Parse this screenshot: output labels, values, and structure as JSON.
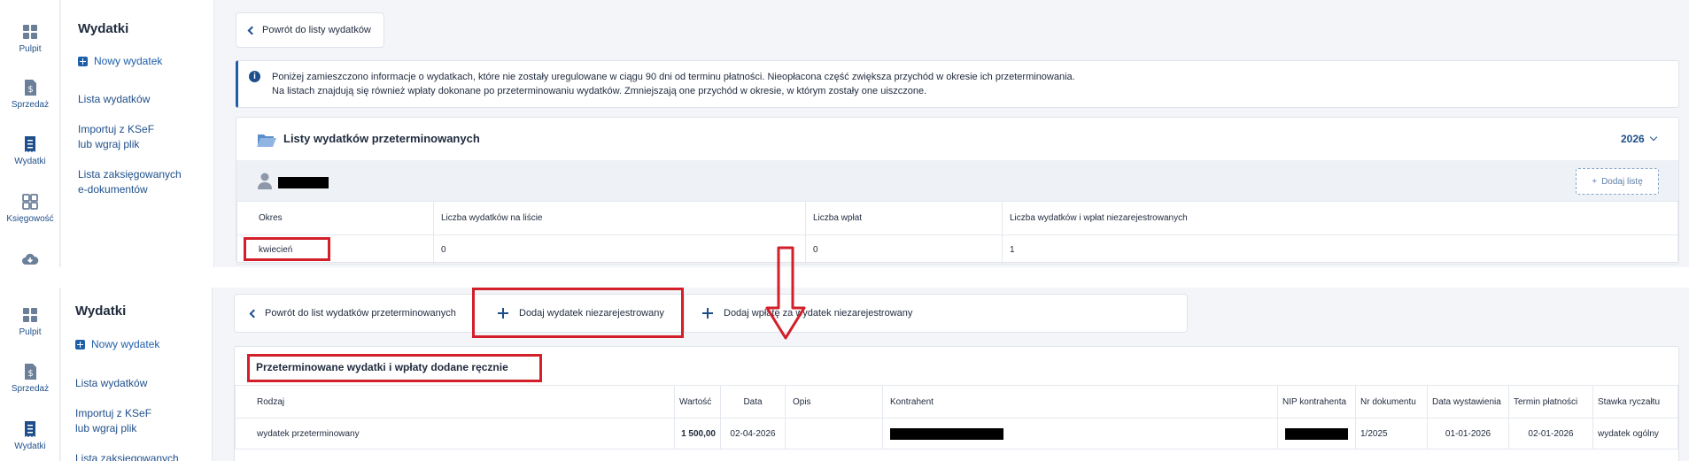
{
  "nav": {
    "pulpit": "Pulpit",
    "sprzedaz": "Sprzedaż",
    "wydatki": "Wydatki",
    "ksiegowosc": "Księgowość"
  },
  "sidebar": {
    "title": "Wydatki",
    "new_expense": "Nowy wydatek",
    "list": "Lista wydatków",
    "import_l1": "Importuj z KSeF",
    "import_l2": "lub wgraj plik",
    "booked_l1": "Lista zaksięgowanych",
    "booked_l2": "e-dokumentów"
  },
  "top": {
    "back_button": "Powrót do listy wydatków",
    "info_line1": "Poniżej zamieszczono informacje o wydatkach, które nie zostały uregulowane w ciągu 90 dni od terminu płatności. Nieopłacona część zwiększa przychód w okresie ich przeterminowania.",
    "info_line2": "Na listach znajdują się również wpłaty dokonane po przeterminowaniu wydatków. Zmniejszają one przychód w okresie, w którym zostały one uiszczone.",
    "card_title": "Listy wydatków przeterminowanych",
    "year": "2026",
    "add_list": "Dodaj listę",
    "columns": [
      "Okres",
      "Liczba wydatków na liście",
      "Liczba wpłat",
      "Liczba wydatków i wpłat niezarejestrowanych"
    ],
    "row": [
      "kwiecień",
      "0",
      "0",
      "1"
    ]
  },
  "bottom": {
    "back_button": "Powrót do list wydatków przeterminowanych",
    "add_unregistered": "Dodaj wydatek niezarejestrowany",
    "add_payment": "Dodaj wpłatę za wydatek niezarejestrowany",
    "card_title": "Przeterminowane wydatki i wpłaty dodane ręcznie",
    "columns": [
      "Rodzaj",
      "Wartość",
      "Data",
      "Opis",
      "Kontrahent",
      "NIP kontrahenta",
      "Nr dokumentu",
      "Data wystawienia",
      "Termin płatności",
      "Stawka ryczałtu"
    ],
    "row": {
      "rodzaj": "wydatek przeterminowany",
      "wartosc": "1 500,00",
      "data": "02-04-2026",
      "opis": "",
      "nr": "1/2025",
      "wystawienia": "01-01-2026",
      "termin": "02-01-2026",
      "stawka": "wydatek ogólny"
    }
  },
  "colors": {
    "accent": "#1f5fa8",
    "highlight": "#d21f2a"
  }
}
